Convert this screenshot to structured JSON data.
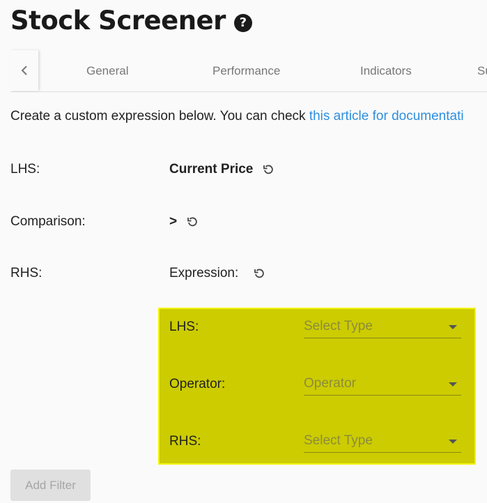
{
  "header": {
    "title": "Stock Screener",
    "help_icon": "question-circle-icon"
  },
  "tabs": [
    {
      "label": "General"
    },
    {
      "label": "Performance"
    },
    {
      "label": "Indicators"
    },
    {
      "label": "Su"
    }
  ],
  "intro": {
    "text": "Create a custom expression below. You can check ",
    "link": "this article for documentati"
  },
  "fields": {
    "lhs": {
      "label": "LHS:",
      "value": "Current Price"
    },
    "comparison": {
      "label": "Comparison:",
      "value": ">"
    },
    "rhs": {
      "label": "RHS:",
      "value": "Expression:"
    }
  },
  "expression": {
    "highlight_color": "#cccc00",
    "lhs": {
      "label": "LHS:",
      "placeholder": "Select Type"
    },
    "operator": {
      "label": "Operator:",
      "placeholder": "Operator"
    },
    "rhs": {
      "label": "RHS:",
      "placeholder": "Select Type"
    }
  },
  "actions": {
    "add_filter": "Add Filter"
  },
  "colors": {
    "link": "#2f8fde",
    "background": "#fafafa"
  }
}
